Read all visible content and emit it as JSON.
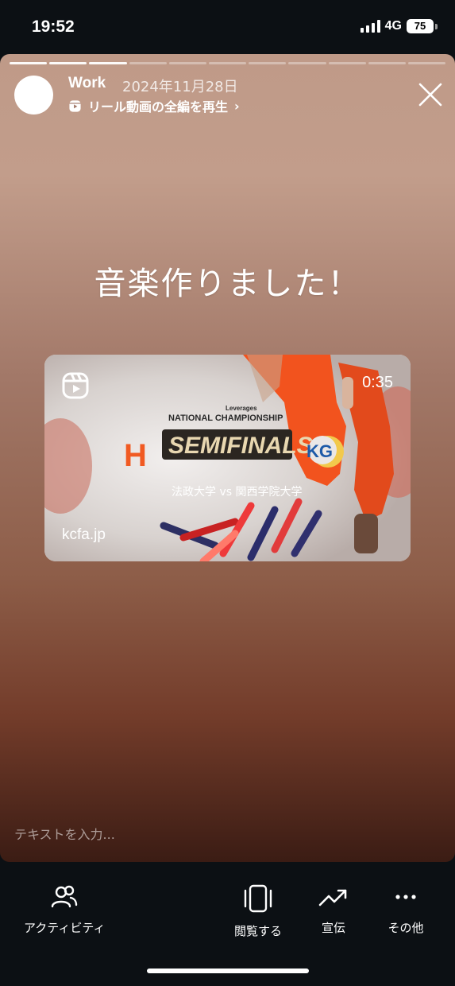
{
  "status_bar": {
    "time": "19:52",
    "network": "4G",
    "battery": "75"
  },
  "story": {
    "username": "Work",
    "date": "2024年11月28日",
    "reel_link": "リール動画の全編を再生",
    "headline": "音楽作りました！",
    "text_input_placeholder": "テキストを入力..."
  },
  "reel_card": {
    "duration": "0:35",
    "domain": "kcfa.jp",
    "sponsor": "Leverages",
    "event_title": "NATIONAL CHAMPIONSHIP",
    "event_name": "SEMIFINALS",
    "team_left_logo": "H",
    "team_right_logo": "KG",
    "matchup": "法政大学 vs 関西学院大学"
  },
  "bottom_nav": {
    "activity": "アクティビティ",
    "view": "閲覧する",
    "promote": "宣伝",
    "more": "その他"
  },
  "icons": [
    "reels-icon",
    "close-icon",
    "people-icon",
    "phone-frame-icon",
    "trending-up-icon",
    "more-icon"
  ]
}
